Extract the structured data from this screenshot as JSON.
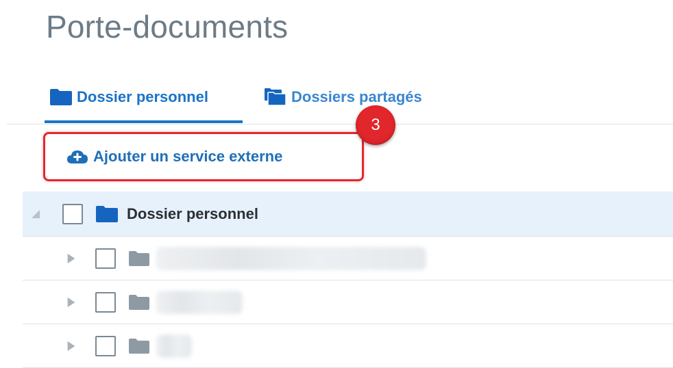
{
  "page": {
    "title": "Porte-documents"
  },
  "tabs": [
    {
      "label": "Dossier personnel",
      "icon": "folder-icon",
      "active": true
    },
    {
      "label": "Dossiers partagés",
      "icon": "folders-stack-icon",
      "active": false
    }
  ],
  "annotation": {
    "step": "3"
  },
  "toolbar": {
    "add_service_label": "Ajouter un service externe",
    "icon": "cloud-upload-icon"
  },
  "tree": {
    "root": {
      "label": "Dossier personnel",
      "expanded": true
    },
    "children": [
      {
        "label": "",
        "expanded": false
      },
      {
        "label": "",
        "expanded": false
      },
      {
        "label": "",
        "expanded": false
      }
    ]
  },
  "colors": {
    "accent": "#1a73c8",
    "highlight": "#e5262b",
    "selected_row": "#e6f1fb",
    "folder_active": "#1565c0",
    "folder_inactive": "#8e9aa3"
  }
}
